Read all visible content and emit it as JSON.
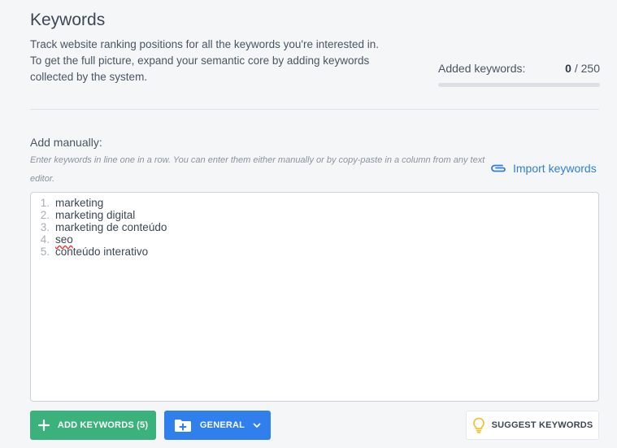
{
  "header": {
    "title": "Keywords",
    "description_lines": [
      "Track website ranking positions for all the keywords you're interested in.",
      "To get the full picture, expand your semantic core by adding keywords",
      "collected by the system."
    ]
  },
  "counter": {
    "label": "Added keywords:",
    "current": "0",
    "separator": "/",
    "max": "250",
    "progress_fraction": 0
  },
  "manual": {
    "label": "Add manually:",
    "hint": "Enter keywords in line one in a row. You can enter them either manually or by copy-paste in a column from any text editor.",
    "import_label": "Import keywords"
  },
  "editor": {
    "lines": [
      {
        "num": "1.",
        "text": "marketing"
      },
      {
        "num": "2.",
        "text": "marketing digital"
      },
      {
        "num": "3.",
        "text": "marketing de conteúdo"
      },
      {
        "num": "4.",
        "text": "seo"
      },
      {
        "num": "5.",
        "text": "conteúdo interativo"
      }
    ]
  },
  "actions": {
    "add_label": "ADD KEYWORDS (5)",
    "group_label": "GENERAL",
    "suggest_label": "SUGGEST KEYWORDS"
  },
  "colors": {
    "accent_blue": "#2f80ed",
    "accent_green": "#3bb17b",
    "spellcheck_red": "#e2362d",
    "bulb_yellow": "#f2c230"
  },
  "icons": {
    "import": "paperclip-icon",
    "add": "plus-icon",
    "group": "folder-plus-icon",
    "dropdown": "chevron-down-icon",
    "suggest": "lightbulb-icon"
  }
}
